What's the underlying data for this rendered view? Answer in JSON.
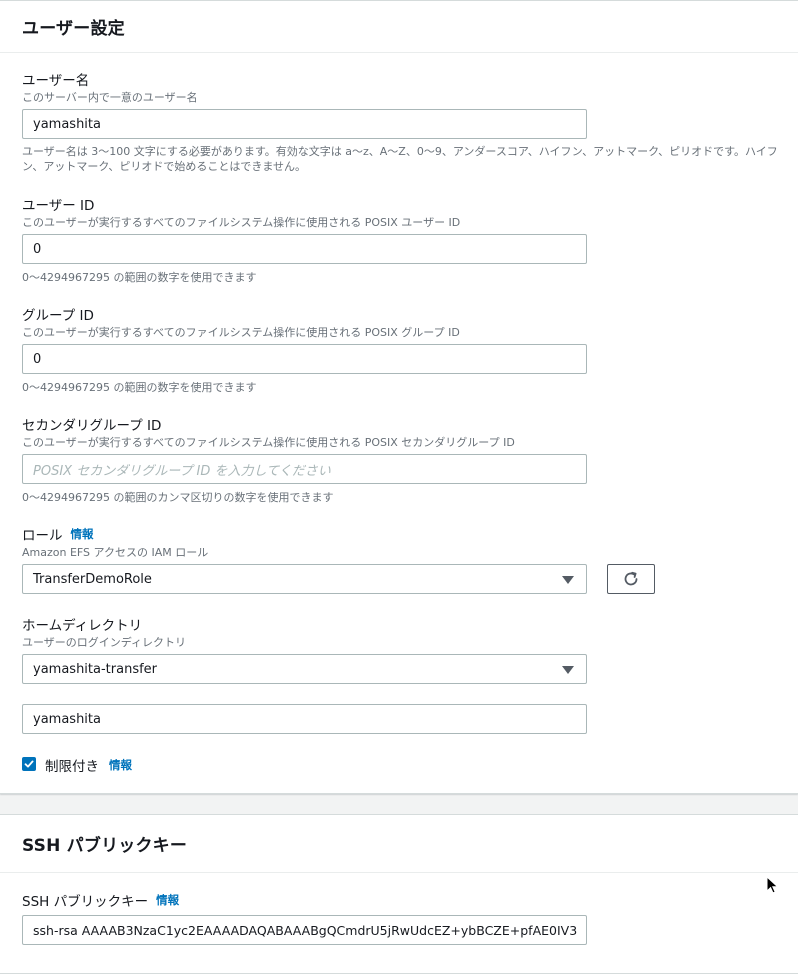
{
  "user_settings": {
    "title": "ユーザー設定",
    "username": {
      "label": "ユーザー名",
      "description": "このサーバー内で一意のユーザー名",
      "value": "yamashita",
      "constraint": "ユーザー名は 3〜100 文字にする必要があります。有効な文字は a〜z、A〜Z、0〜9、アンダースコア、ハイフン、アットマーク、ピリオドです。ハイフン、アットマーク、ピリオドで始めることはできません。"
    },
    "user_id": {
      "label": "ユーザー ID",
      "description": "このユーザーが実行するすべてのファイルシステム操作に使用される POSIX ユーザー ID",
      "value": "0",
      "constraint": "0〜4294967295 の範囲の数字を使用できます"
    },
    "group_id": {
      "label": "グループ ID",
      "description": "このユーザーが実行するすべてのファイルシステム操作に使用される POSIX グループ ID",
      "value": "0",
      "constraint": "0〜4294967295 の範囲の数字を使用できます"
    },
    "secondary_group_ids": {
      "label": "セカンダリグループ ID",
      "description": "このユーザーが実行するすべてのファイルシステム操作に使用される POSIX セカンダリグループ ID",
      "value": "",
      "placeholder": "POSIX セカンダリグループ ID を入力してください",
      "constraint": "0〜4294967295 の範囲のカンマ区切りの数字を使用できます"
    },
    "role": {
      "label": "ロール",
      "info": "情報",
      "description": "Amazon EFS アクセスの IAM ロール",
      "selected": "TransferDemoRole",
      "refresh_icon": "refresh-icon"
    },
    "home_directory": {
      "label": "ホームディレクトリ",
      "description": "ユーザーのログインディレクトリ",
      "selected": "yamashita-transfer",
      "path_value": "yamashita"
    },
    "restricted": {
      "label": "制限付き",
      "info": "情報",
      "checked": true
    }
  },
  "ssh_public_key": {
    "title": "SSH パブリックキー",
    "label": "SSH パブリックキー",
    "info": "情報",
    "value": "ssh-rsa AAAAB3NzaC1yc2EAAAADAQABAAABgQCmdrU5jRwUdcEZ+ybBCZE+pfAE0IV3"
  },
  "colors": {
    "link": "#0073bb",
    "checkbox": "#0073bb",
    "border": "#aab7b8",
    "background": "#f2f3f3"
  }
}
